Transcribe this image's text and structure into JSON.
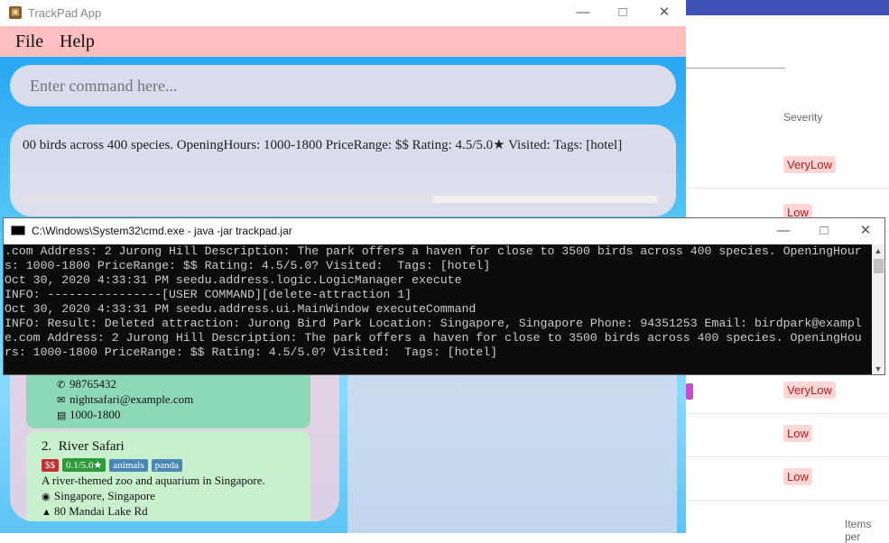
{
  "background_app": {
    "severity_header": "Severity",
    "rows": [
      "VeryLow",
      "Low",
      "VeryLow",
      "Low",
      "Low"
    ],
    "items_per_page": "Items per"
  },
  "trackpad": {
    "title": "TrackPad App",
    "menu": {
      "file": "File",
      "help": "Help"
    },
    "command_placeholder": "Enter command here...",
    "result_text": "00 birds across 400 species. OpeningHours: 1000-1800 PriceRange: $$ Rating: 4.5/5.0★ Visited:  Tags: [hotel]",
    "attractions": [
      {
        "phone": "98765432",
        "email": "nightsafari@example.com",
        "hours": "1000-1800"
      },
      {
        "index": "2.",
        "name": "River Safari",
        "price": "$$",
        "rating": "0.1/5.0★",
        "tags": [
          "animals",
          "panda"
        ],
        "description": "A river-themed zoo and aquarium in Singapore.",
        "location": "Singapore, Singapore",
        "address": "80 Mandai Lake Rd"
      }
    ]
  },
  "cmd": {
    "title": "C:\\Windows\\System32\\cmd.exe - java  -jar trackpad.jar",
    "lines": [
      ".com Address: 2 Jurong Hill Description: The park offers a haven for close to 3500 birds across 400 species. OpeningHour",
      "s: 1000-1800 PriceRange: $$ Rating: 4.5/5.0? Visited:  Tags: [hotel]",
      "Oct 30, 2020 4:33:31 PM seedu.address.logic.LogicManager execute",
      "INFO: ----------------[USER COMMAND][delete-attraction 1]",
      "Oct 30, 2020 4:33:31 PM seedu.address.ui.MainWindow executeCommand",
      "INFO: Result: Deleted attraction: Jurong Bird Park Location: Singapore, Singapore Phone: 94351253 Email: birdpark@exampl",
      "e.com Address: 2 Jurong Hill Description: The park offers a haven for close to 3500 birds across 400 species. OpeningHou",
      "rs: 1000-1800 PriceRange: $$ Rating: 4.5/5.0? Visited:  Tags: [hotel]"
    ]
  },
  "icons": {
    "minimize": "minimize-icon",
    "maximize": "maximize-icon",
    "close": "close-icon",
    "phone": "phone-icon",
    "email": "email-icon",
    "hours": "calendar-icon",
    "location": "globe-icon",
    "address": "house-icon"
  },
  "colors": {
    "menubar": "#ffbfc1",
    "cmd_bg": "#0c0c0c",
    "price_tag": "#c03030",
    "rating_tag": "#2e9b3a",
    "tag": "#4a86b5",
    "severity_badge": "#ffd6d6"
  }
}
